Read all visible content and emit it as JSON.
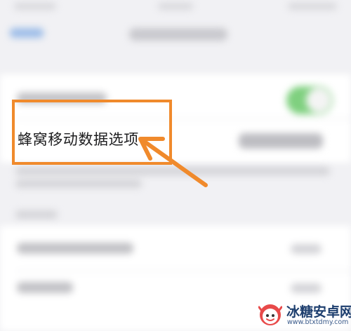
{
  "settings": {
    "cellular_data_options_label": "蜂窝移动数据选项"
  },
  "annotation": {
    "highlight_color": "#f08a2c"
  },
  "watermark": {
    "name": "冰糖安卓网",
    "url": "www.btxtdmy.com",
    "logo_icon": "candy-face-icon"
  },
  "colors": {
    "toggle_on": "#7fd07f",
    "link_blue": "#9dbde8"
  }
}
